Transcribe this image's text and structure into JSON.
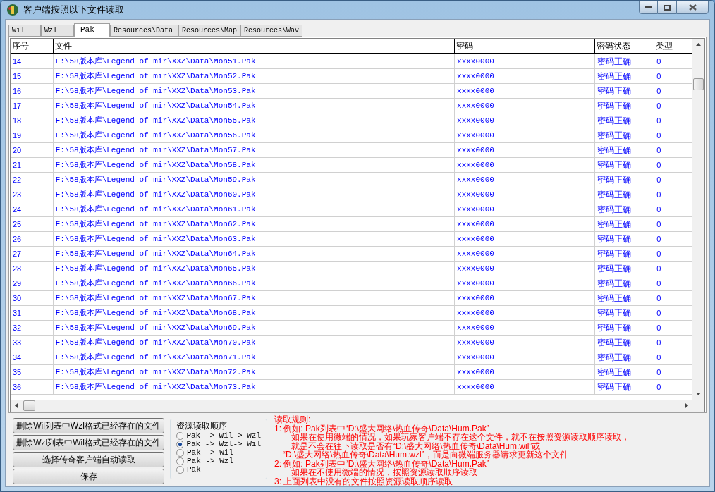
{
  "window": {
    "title": "客户端按照以下文件读取"
  },
  "tabs": [
    {
      "label": "Wil",
      "selected": false
    },
    {
      "label": "Wzl",
      "selected": false
    },
    {
      "label": "Pak",
      "selected": true
    },
    {
      "label": "Resources\\Data",
      "selected": false
    },
    {
      "label": "Resources\\Map",
      "selected": false
    },
    {
      "label": "Resources\\Wav",
      "selected": false
    }
  ],
  "table": {
    "columns": [
      "序号",
      "文件",
      "密码",
      "密码状态",
      "类型"
    ],
    "rows": [
      [
        "14",
        "F:\\58版本库\\Legend of mir\\XXZ\\Data\\Mon51.Pak",
        "xxxx0000",
        "密码正确",
        "0"
      ],
      [
        "15",
        "F:\\58版本库\\Legend of mir\\XXZ\\Data\\Mon52.Pak",
        "xxxx0000",
        "密码正确",
        "0"
      ],
      [
        "16",
        "F:\\58版本库\\Legend of mir\\XXZ\\Data\\Mon53.Pak",
        "xxxx0000",
        "密码正确",
        "0"
      ],
      [
        "17",
        "F:\\58版本库\\Legend of mir\\XXZ\\Data\\Mon54.Pak",
        "xxxx0000",
        "密码正确",
        "0"
      ],
      [
        "18",
        "F:\\58版本库\\Legend of mir\\XXZ\\Data\\Mon55.Pak",
        "xxxx0000",
        "密码正确",
        "0"
      ],
      [
        "19",
        "F:\\58版本库\\Legend of mir\\XXZ\\Data\\Mon56.Pak",
        "xxxx0000",
        "密码正确",
        "0"
      ],
      [
        "20",
        "F:\\58版本库\\Legend of mir\\XXZ\\Data\\Mon57.Pak",
        "xxxx0000",
        "密码正确",
        "0"
      ],
      [
        "21",
        "F:\\58版本库\\Legend of mir\\XXZ\\Data\\Mon58.Pak",
        "xxxx0000",
        "密码正确",
        "0"
      ],
      [
        "22",
        "F:\\58版本库\\Legend of mir\\XXZ\\Data\\Mon59.Pak",
        "xxxx0000",
        "密码正确",
        "0"
      ],
      [
        "23",
        "F:\\58版本库\\Legend of mir\\XXZ\\Data\\Mon60.Pak",
        "xxxx0000",
        "密码正确",
        "0"
      ],
      [
        "24",
        "F:\\58版本库\\Legend of mir\\XXZ\\Data\\Mon61.Pak",
        "xxxx0000",
        "密码正确",
        "0"
      ],
      [
        "25",
        "F:\\58版本库\\Legend of mir\\XXZ\\Data\\Mon62.Pak",
        "xxxx0000",
        "密码正确",
        "0"
      ],
      [
        "26",
        "F:\\58版本库\\Legend of mir\\XXZ\\Data\\Mon63.Pak",
        "xxxx0000",
        "密码正确",
        "0"
      ],
      [
        "27",
        "F:\\58版本库\\Legend of mir\\XXZ\\Data\\Mon64.Pak",
        "xxxx0000",
        "密码正确",
        "0"
      ],
      [
        "28",
        "F:\\58版本库\\Legend of mir\\XXZ\\Data\\Mon65.Pak",
        "xxxx0000",
        "密码正确",
        "0"
      ],
      [
        "29",
        "F:\\58版本库\\Legend of mir\\XXZ\\Data\\Mon66.Pak",
        "xxxx0000",
        "密码正确",
        "0"
      ],
      [
        "30",
        "F:\\58版本库\\Legend of mir\\XXZ\\Data\\Mon67.Pak",
        "xxxx0000",
        "密码正确",
        "0"
      ],
      [
        "31",
        "F:\\58版本库\\Legend of mir\\XXZ\\Data\\Mon68.Pak",
        "xxxx0000",
        "密码正确",
        "0"
      ],
      [
        "32",
        "F:\\58版本库\\Legend of mir\\XXZ\\Data\\Mon69.Pak",
        "xxxx0000",
        "密码正确",
        "0"
      ],
      [
        "33",
        "F:\\58版本库\\Legend of mir\\XXZ\\Data\\Mon70.Pak",
        "xxxx0000",
        "密码正确",
        "0"
      ],
      [
        "34",
        "F:\\58版本库\\Legend of mir\\XXZ\\Data\\Mon71.Pak",
        "xxxx0000",
        "密码正确",
        "0"
      ],
      [
        "35",
        "F:\\58版本库\\Legend of mir\\XXZ\\Data\\Mon72.Pak",
        "xxxx0000",
        "密码正确",
        "0"
      ],
      [
        "36",
        "F:\\58版本库\\Legend of mir\\XXZ\\Data\\Mon73.Pak",
        "xxxx0000",
        "密码正确",
        "0"
      ]
    ]
  },
  "buttons": [
    "删除Wil列表中Wzl格式已经存在的文件",
    "删除Wzl列表中Wil格式已经存在的文件",
    "选择传奇客户端自动读取",
    "保存"
  ],
  "read_order": {
    "title": "资源读取顺序",
    "options": [
      {
        "label": "Pak -> Wil-> Wzl",
        "selected": false
      },
      {
        "label": "Pak -> Wzl-> Wil",
        "selected": true
      },
      {
        "label": "Pak -> Wil",
        "selected": false
      },
      {
        "label": "Pak -> Wzl",
        "selected": false
      },
      {
        "label": "Pak",
        "selected": false
      }
    ]
  },
  "rules": [
    {
      "kind": "heading",
      "text": "读取规则:"
    },
    {
      "kind": "item",
      "text": "1: 例如: Pak列表中“D:\\盛大网络\\热血传奇\\Data\\Hum.Pak”"
    },
    {
      "kind": "continuation",
      "text": "如果在使用微端的情况，如果玩家客户端不存在这个文件，就不在按照资源读取顺序读取，"
    },
    {
      "kind": "continuation",
      "text": "就是不会在往下读取是否有“D:\\盛大网络\\热血传奇\\Data\\Hum.wil”或"
    },
    {
      "kind": "quote",
      "text": "“D:\\盛大网络\\热血传奇\\Data\\Hum.wzl”，而是向微端服务器请求更新这个文件"
    },
    {
      "kind": "item",
      "text": "2: 例如: Pak列表中“D:\\盛大网络\\热血传奇\\Data\\Hum.Pak”"
    },
    {
      "kind": "continuation",
      "text": "如果在不使用微端的情况，按照资源读取顺序读取"
    },
    {
      "kind": "item",
      "text": "3: 上面列表中没有的文件按照资源读取顺序读取"
    }
  ]
}
